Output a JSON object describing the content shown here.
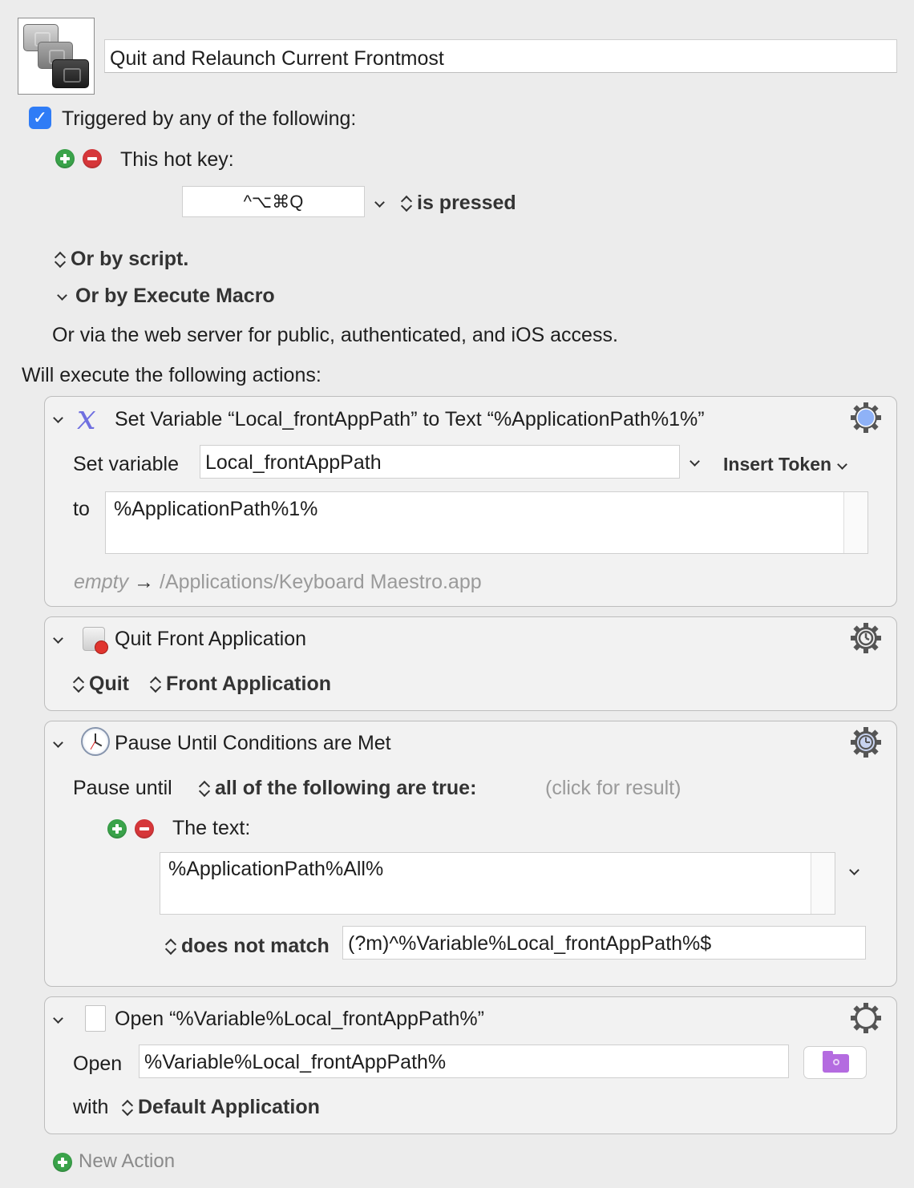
{
  "macro": {
    "title": "Quit and Relaunch Current Frontmost",
    "triggered_label": "Triggered by any of the following:",
    "triggered_checked": true,
    "hotkey_label": "This hot key:",
    "hotkey_value": "^⌥⌘Q",
    "hotkey_state": "is pressed",
    "or_by_script": "Or by script.",
    "or_by_execute_macro": "Or by Execute Macro",
    "web_server_text": "Or via the web server for public, authenticated, and iOS access.",
    "will_execute": "Will execute the following actions:"
  },
  "actions": [
    {
      "title": "Set Variable “Local_frontAppPath” to Text “%ApplicationPath%1%”",
      "set_variable_label": "Set variable",
      "variable_name": "Local_frontAppPath",
      "insert_token": "Insert Token",
      "to_label": "to",
      "to_value": "%ApplicationPath%1%",
      "preview_empty": "empty",
      "preview_arrow": "→",
      "preview_value": "/Applications/Keyboard Maestro.app"
    },
    {
      "title": "Quit Front Application",
      "mode": "Quit",
      "target": "Front Application"
    },
    {
      "title": "Pause Until Conditions are Met",
      "pause_until_label": "Pause until",
      "condition_mode": "all of the following are true:",
      "click_for_result": "(click for result)",
      "condition_label": "The text:",
      "text_value": "%ApplicationPath%All%",
      "match_mode": "does not match",
      "pattern": "(?m)^%Variable%Local_frontAppPath%$"
    },
    {
      "title": "Open “%Variable%Local_frontAppPath%”",
      "open_label": "Open",
      "open_value": "%Variable%Local_frontAppPath%",
      "with_label": "with",
      "application": "Default Application"
    }
  ],
  "new_action": "New Action",
  "icons": [
    "macro-icon",
    "variable-icon",
    "quit-app-icon",
    "clock-icon",
    "document-icon",
    "gear-icon",
    "folder-icon"
  ]
}
